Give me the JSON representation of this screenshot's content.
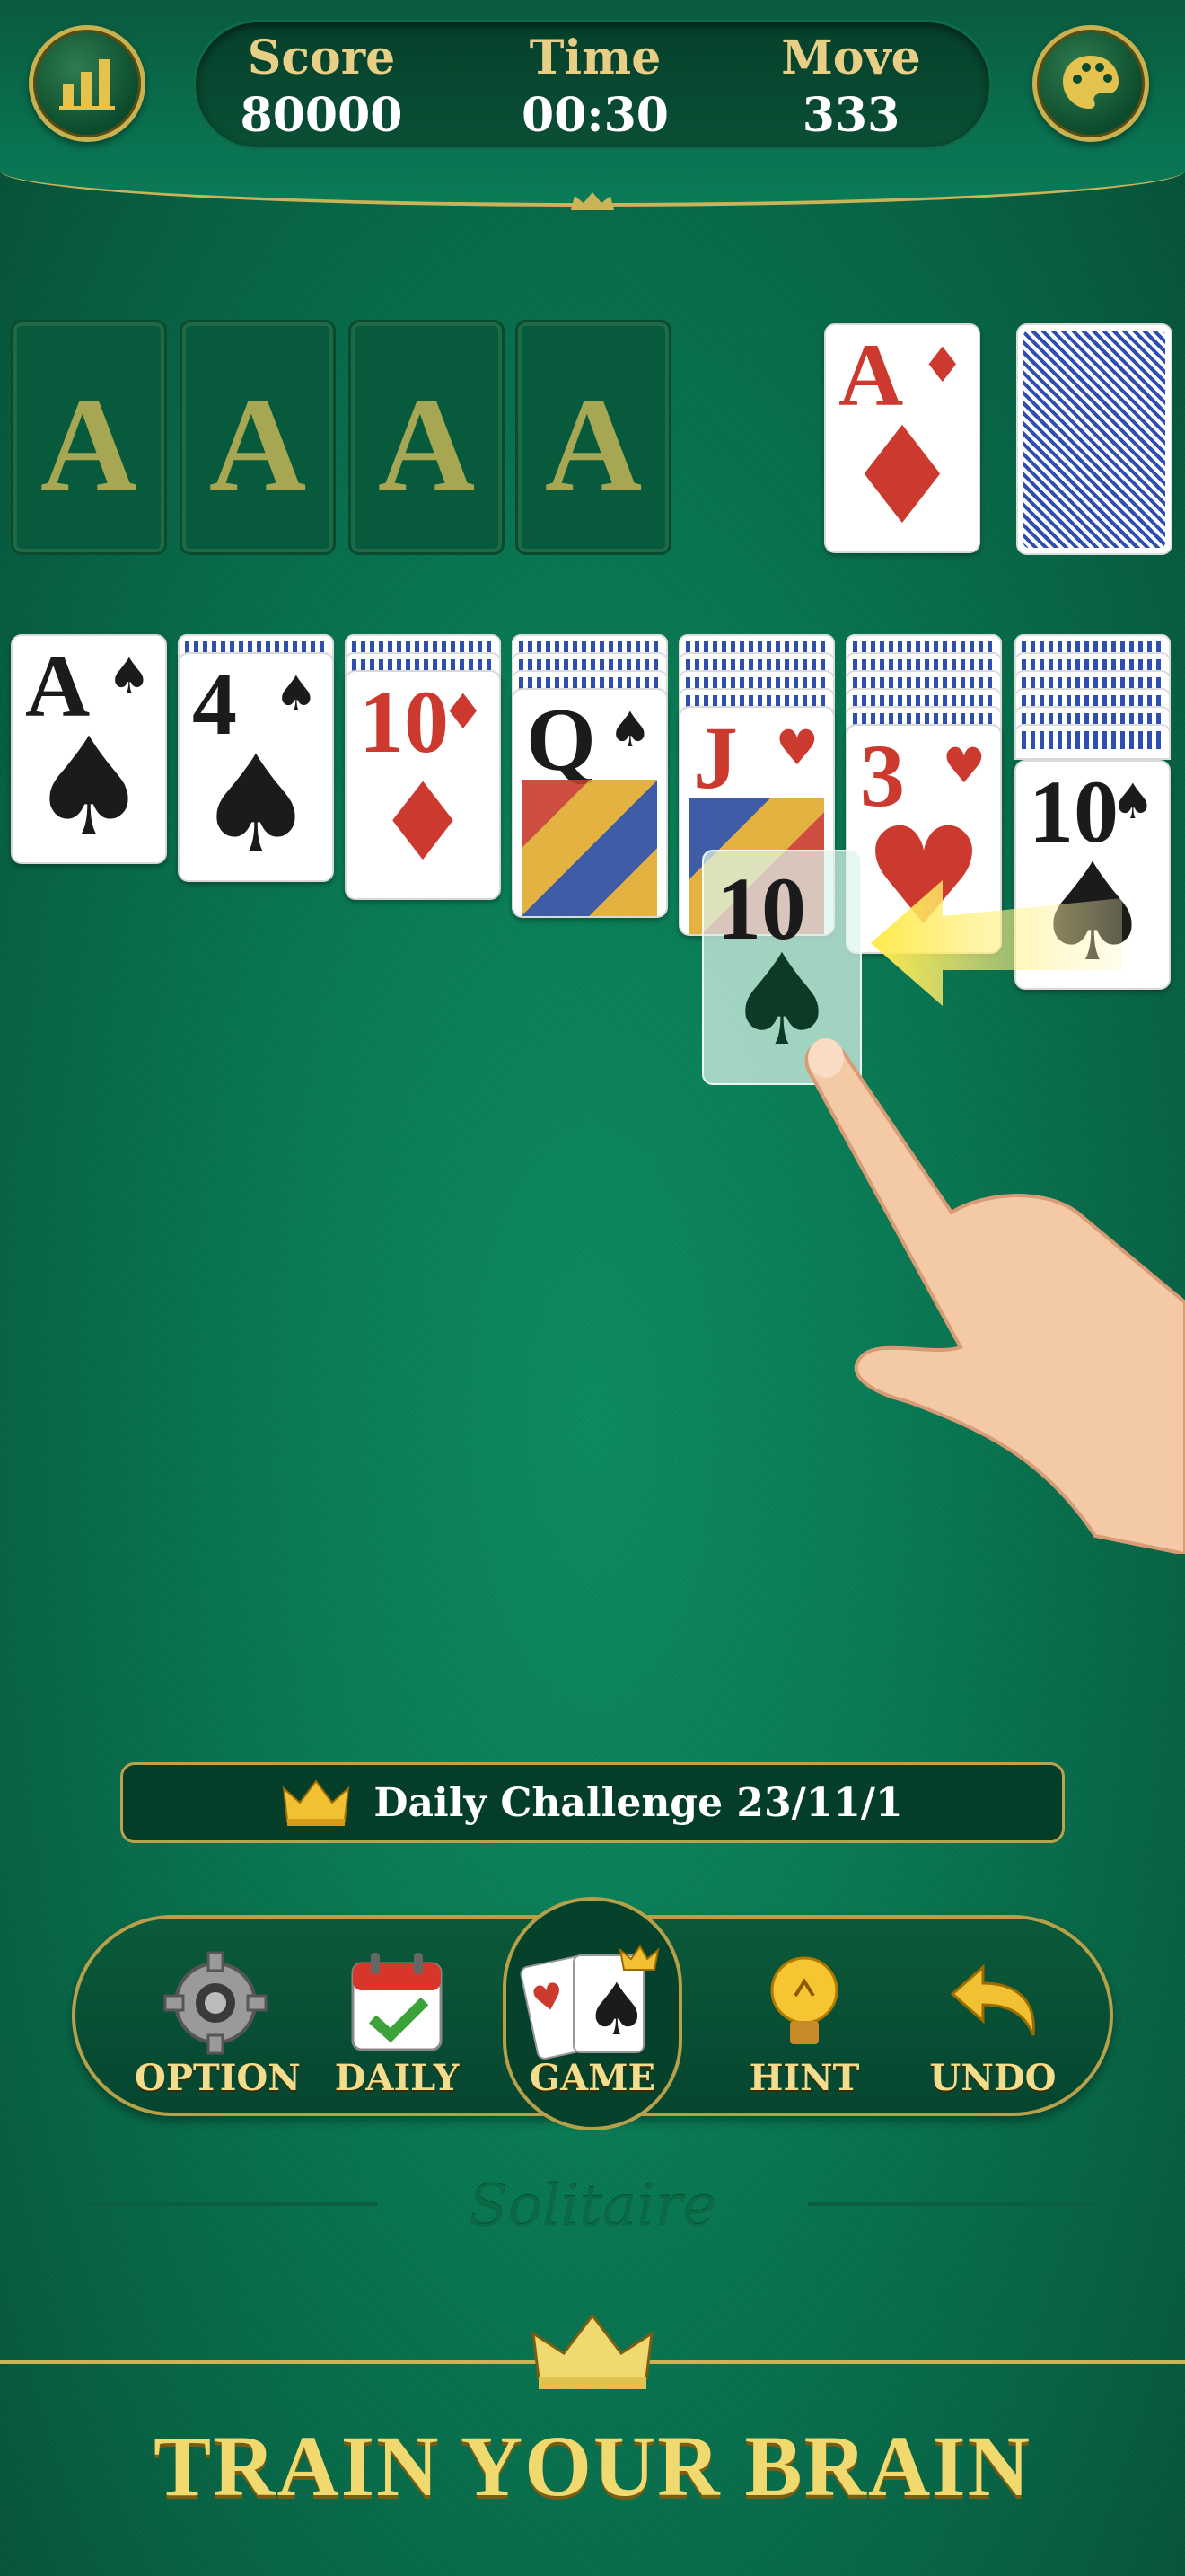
{
  "stats": {
    "score_label": "Score",
    "score_value": "80000",
    "time_label": "Time",
    "time_value": "00:30",
    "move_label": "Move",
    "move_value": "333"
  },
  "foundations": [
    "A",
    "A",
    "A",
    "A"
  ],
  "waste": {
    "rank": "A",
    "suit": "♦",
    "color": "red"
  },
  "tableau": [
    {
      "rank": "A",
      "suit": "♠",
      "color": "black"
    },
    {
      "rank": "4",
      "suit": "♠",
      "color": "black"
    },
    {
      "rank": "10",
      "suit": "♦",
      "color": "red"
    },
    {
      "rank": "Q",
      "suit": "♠",
      "color": "black"
    },
    {
      "rank": "J",
      "suit": "♥",
      "color": "red"
    },
    {
      "rank": "3",
      "suit": "♥",
      "color": "red"
    },
    {
      "rank": "10",
      "suit": "♠",
      "color": "black"
    }
  ],
  "dragging_card": {
    "rank": "10",
    "suit": "♠"
  },
  "challenge": {
    "text": "Daily Challenge 23/11/1"
  },
  "menu": {
    "option": "OPTION",
    "daily": "DAILY",
    "game": "GAME",
    "hint": "HINT",
    "undo": "UNDO"
  },
  "brand": "Solitaire",
  "banner": "TRAIN YOUR BRAIN",
  "colors": {
    "felt": "#087a54",
    "gold": "#c9b45a",
    "card_red": "#cc3a2f",
    "card_back": "#2f4fb0"
  }
}
